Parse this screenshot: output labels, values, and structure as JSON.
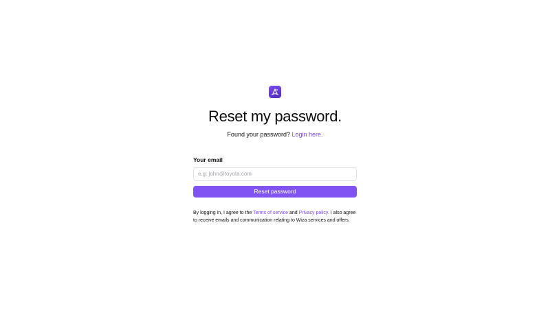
{
  "logo": {
    "icon": "wiza-logo-icon",
    "accent": "#7b4cf0"
  },
  "header": {
    "title": "Reset my password.",
    "subtitle_prefix": "Found your password?",
    "login_link": "Login here."
  },
  "form": {
    "email_label": "Your email",
    "email_placeholder": "e.g: john@toyota.com",
    "email_value": "",
    "submit_label": "Reset password"
  },
  "legal": {
    "part1": "By logging in, I agree to the ",
    "terms_link": "Terms of service",
    "part2": " and ",
    "privacy_link": "Privacy policy.",
    "part3": " I also agree to receive emails and communication relating to Wiza services and offers."
  },
  "colors": {
    "primary": "#8153f2",
    "link": "#7a45ee",
    "border": "#e2e2e6"
  }
}
